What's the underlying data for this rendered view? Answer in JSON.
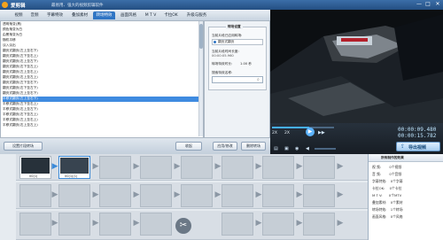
{
  "app": {
    "title": "爱剪辑",
    "subtitle": "最易用、强大的视频剪辑软件"
  },
  "window_buttons": [
    "—",
    "□",
    "✕"
  ],
  "tabs": [
    {
      "label": "视频"
    },
    {
      "label": "音频"
    },
    {
      "label": "字幕特效"
    },
    {
      "label": "叠加素材"
    },
    {
      "label": "转场特效"
    },
    {
      "label": "画面风格"
    },
    {
      "label": "M T V"
    },
    {
      "label": "卡拉OK"
    },
    {
      "label": "升级与服务"
    }
  ],
  "transition_list": [
    "透明渐变(黑)",
    "颜色渐变为白",
    "由黑渐变为白",
    "随机平移",
    "淡入淡出",
    "翻页式翻页(左上至右下)",
    "翻页式翻页(左下至右上)",
    "翻页式翻页(右上至左下)",
    "翻页式翻页(右下至左上)",
    "翻页式翻页(左上至右上)",
    "翻页式翻页(右上至左上)",
    "翻页式翻页(左下至右下)",
    "翻页式翻页(右下至左下)",
    "翻页式翻页(左上至右下)",
    "平移式翻页(左上至右下)",
    "平移式翻页(左下至右上)",
    "平移式翻页(右上至左下)",
    "平移式翻页(右下至左上)",
    "平移式翻页(左上至右上)",
    "平移式翻页(右上至左上)"
  ],
  "selected_index": 14,
  "settings": {
    "header": "转场设置",
    "applied_label": "当前片段已应用转场:",
    "applied_value": "翻页式翻页",
    "duration_label": "当前片段时间长度:",
    "duration_value": "00:00:05.960",
    "transition_duration_label": "转场特效时长:",
    "transition_duration_value": "1.00 秒",
    "search_label": "搜索特效名称:",
    "search_value": "",
    "apply_button": "应用/修改",
    "delete_button": "删除转场"
  },
  "bottom_toolbar": {
    "clip_settings": "设置片段转场",
    "collapse": "收起"
  },
  "player": {
    "current_time": "00:00:09.480",
    "total_time": "00:00:15.782",
    "speed_label": "2X",
    "speed_label_2": "2X",
    "export_button": "导出视频"
  },
  "timeline": {
    "side_label": "已添加片段",
    "clips": [
      {
        "name": "00.00",
        "label": "00(1)"
      },
      {
        "name": "00.30",
        "label": "00(1)(1)"
      }
    ]
  },
  "stats": {
    "header": "所有制作的效果",
    "rows": [
      {
        "label": "视 频:",
        "value": "0个视频"
      },
      {
        "label": "音 频:",
        "value": "0个音频"
      },
      {
        "label": "字幕特效:",
        "value": "0个字幕"
      },
      {
        "label": "卡拉OK:",
        "value": "0个卡拉"
      },
      {
        "label": "M T V:",
        "value": "0个MTV"
      },
      {
        "label": "叠加素材:",
        "value": "0个素材"
      },
      {
        "label": "转场特效:",
        "value": "1个转场"
      },
      {
        "label": "画面风格:",
        "value": "0个风格"
      }
    ]
  },
  "colors": {
    "accent": "#2f75c4",
    "selected": "#3f8be0"
  }
}
